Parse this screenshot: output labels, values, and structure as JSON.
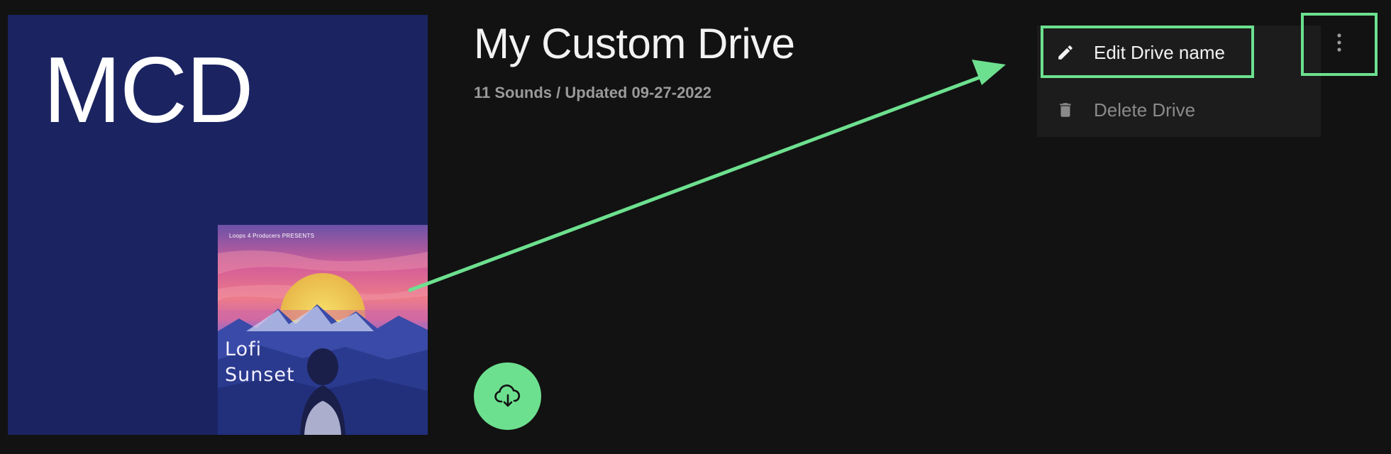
{
  "cover": {
    "initials": "MCD",
    "artwork": {
      "presenter": "Loops 4 Producers  PRESENTS",
      "title": "Lofi\nSunset"
    }
  },
  "drive": {
    "title": "My Custom Drive",
    "meta": "11 Sounds / Updated 09-27-2022"
  },
  "menu": {
    "items": [
      {
        "label": "Edit Drive name",
        "icon": "pencil-icon"
      },
      {
        "label": "Delete Drive",
        "icon": "trash-icon"
      }
    ]
  },
  "buttons": {
    "download_icon": "cloud-download-icon",
    "more_icon": "more-vertical-icon"
  },
  "colors": {
    "background": "#121212",
    "cover_background": "#1b2461",
    "accent_green": "#6de08f",
    "menu_background": "#1c1c1c",
    "muted_text": "#9a9a9a"
  }
}
